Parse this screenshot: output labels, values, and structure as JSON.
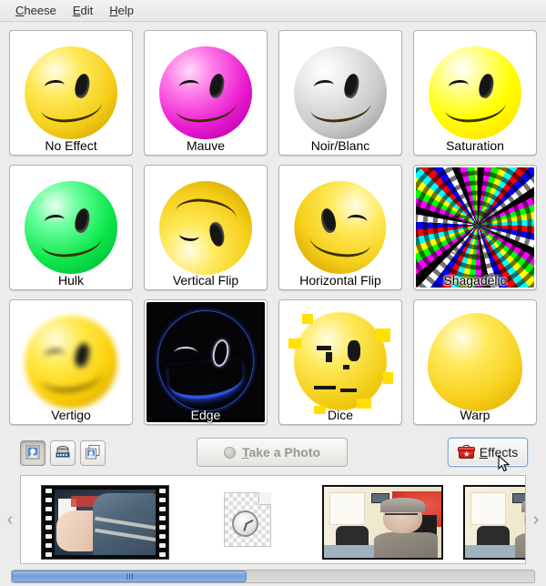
{
  "app": {
    "title": "Cheese"
  },
  "menubar": {
    "items": [
      {
        "label": "Cheese",
        "mnemonic": "C",
        "rest": "heese"
      },
      {
        "label": "Edit",
        "mnemonic": "E",
        "rest": "dit"
      },
      {
        "label": "Help",
        "mnemonic": "H",
        "rest": "elp"
      }
    ]
  },
  "effects": {
    "tiles": [
      {
        "label": "No Effect",
        "icon": "smiley-yellow-icon"
      },
      {
        "label": "Mauve",
        "icon": "smiley-mauve-icon"
      },
      {
        "label": "Noir/Blanc",
        "icon": "smiley-greyscale-icon"
      },
      {
        "label": "Saturation",
        "icon": "smiley-saturated-icon"
      },
      {
        "label": "Hulk",
        "icon": "smiley-green-icon"
      },
      {
        "label": "Vertical Flip",
        "icon": "smiley-flipped-vertical-icon"
      },
      {
        "label": "Horizontal Flip",
        "icon": "smiley-flipped-horizontal-icon"
      },
      {
        "label": "Shagadelic",
        "icon": "smiley-psychedelic-icon"
      },
      {
        "label": "Vertigo",
        "icon": "smiley-blurred-icon"
      },
      {
        "label": "Edge",
        "icon": "smiley-edge-detect-icon"
      },
      {
        "label": "Dice",
        "icon": "smiley-diced-icon"
      },
      {
        "label": "Warp",
        "icon": "smiley-warped-icon"
      }
    ]
  },
  "toolbar": {
    "mode_buttons": [
      {
        "name": "photo-mode",
        "icon": "photo-icon",
        "active": true
      },
      {
        "name": "video-mode",
        "icon": "film-reel-icon",
        "active": false
      },
      {
        "name": "burst-mode",
        "icon": "multi-photo-icon",
        "active": false
      }
    ],
    "take_photo": {
      "label": "Take a Photo",
      "mnemonic": "T",
      "before": "",
      "rest": "ake a Photo",
      "icon": "shutter-icon"
    },
    "effects": {
      "label": "Effects",
      "mnemonic": "E",
      "rest": "ffects",
      "icon": "toolbox-icon"
    }
  },
  "thumbnails": {
    "prev_arrow": "‹",
    "next_arrow": "›",
    "items": [
      {
        "type": "video",
        "name": "video-thumbnail"
      },
      {
        "type": "placeholder",
        "name": "loading-placeholder",
        "icon": "clock-document-icon"
      },
      {
        "type": "photo",
        "name": "photo-thumbnail"
      },
      {
        "type": "photo",
        "name": "photo-thumbnail"
      }
    ]
  },
  "scrollbar": {
    "thumb_percent": 45,
    "grip": "|||"
  },
  "colors": {
    "background": "#ececec",
    "accent_blue": "#6f9fd8",
    "focus_border": "#7aa3d6",
    "toolbox_red": "#d93a2c"
  }
}
